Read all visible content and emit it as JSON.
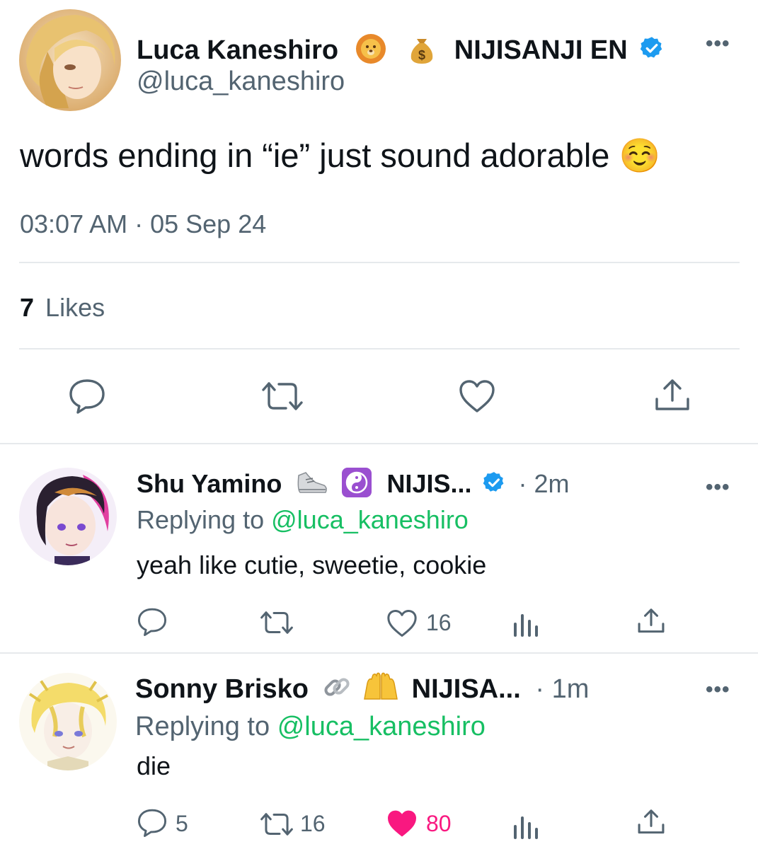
{
  "main_tweet": {
    "display_name": "Luca Kaneshiro",
    "affiliation": "NIJISANJI EN",
    "handle": "@luca_kaneshiro",
    "text": "words ending in “ie” just sound adorable ☺️",
    "timestamp": "03:07 AM · 05 Sep 24",
    "likes_count": "7",
    "likes_label": "Likes",
    "more_label": "•••"
  },
  "replies": [
    {
      "display_name": "Shu Yamino",
      "affiliation": "NIJIS...",
      "time": "· 2m",
      "replying_prefix": "Replying to",
      "replying_handle": "@luca_kaneshiro",
      "text": "yeah like cutie, sweetie, cookie",
      "like_count": "16",
      "more_label": "•••"
    },
    {
      "display_name": "Sonny Brisko",
      "affiliation": "NIJISA...",
      "time": "· 1m",
      "replying_prefix": "Replying to",
      "replying_handle": "@luca_kaneshiro",
      "text": "die",
      "reply_count": "5",
      "retweet_count": "16",
      "like_count": "80",
      "more_label": "•••"
    }
  ],
  "colors": {
    "accent_link": "#17bf63",
    "like_active": "#f91880",
    "verified": "#1d9bf0",
    "muted_text": "#536471"
  }
}
